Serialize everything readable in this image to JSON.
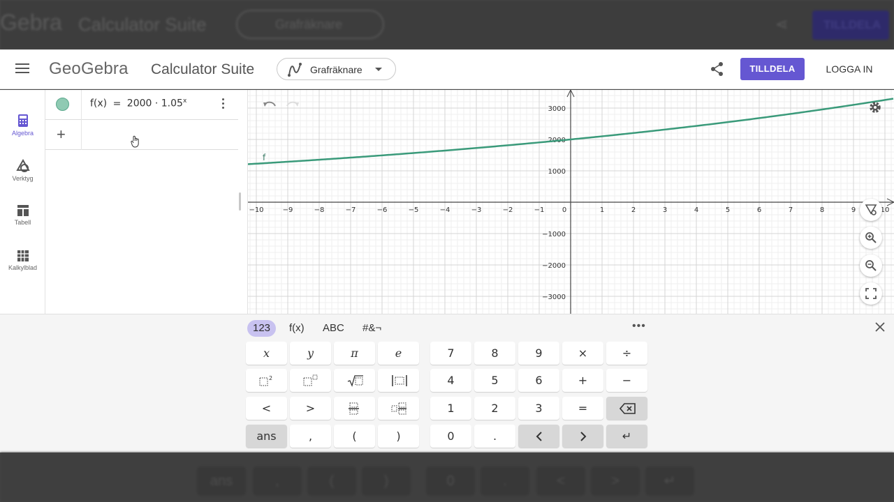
{
  "backdrop": {
    "logo": "Gebra",
    "suite": "Calculator Suite",
    "picker": "Grafräknare",
    "assign": "TILLDELA",
    "keys": [
      "ans",
      ",",
      "(",
      ")",
      "0",
      ".",
      "<",
      ">",
      "↵"
    ]
  },
  "header": {
    "logo": "GeoGebra",
    "suite_title": "Calculator Suite",
    "app_picker": "Grafräknare",
    "assign_label": "TILLDELA",
    "login_label": "LOGGA IN"
  },
  "rail": [
    {
      "label": "Algebra",
      "icon": "calculator-icon",
      "active": true
    },
    {
      "label": "Verktyg",
      "icon": "tools-icon",
      "active": false
    },
    {
      "label": "Tabell",
      "icon": "table-icon",
      "active": false
    },
    {
      "label": "Kalkylblad",
      "icon": "spreadsheet-icon",
      "active": false
    }
  ],
  "algebra": {
    "formula_lhs": "f(x)",
    "formula_eq": "=",
    "formula_rhs": "2000 · 1.05",
    "formula_exp": "x",
    "marble_color": "#8fcab3"
  },
  "graph": {
    "function_label": "f",
    "curve_color": "#3a9a7a",
    "x_ticks": [
      "−10",
      "−9",
      "−8",
      "−7",
      "−6",
      "−5",
      "−4",
      "−3",
      "−2",
      "−1",
      "0",
      "1",
      "2",
      "3",
      "4",
      "5",
      "6",
      "7",
      "8",
      "9",
      "10"
    ],
    "y_ticks": [
      "3000",
      "2000",
      "1000",
      "−1000",
      "−2000",
      "−3000"
    ],
    "xlim": [
      -10,
      10
    ],
    "ylim": [
      -3000,
      3000
    ]
  },
  "keyboard": {
    "tabs": [
      "123",
      "f(x)",
      "ABC",
      "#&¬"
    ],
    "more": "•••",
    "rows": [
      [
        {
          "l": "x",
          "s": "it"
        },
        {
          "l": "y",
          "s": "it"
        },
        {
          "l": "π",
          "s": "it"
        },
        {
          "l": "e",
          "s": "it"
        },
        {
          "l": "7"
        },
        {
          "l": "8"
        },
        {
          "l": "9"
        },
        {
          "l": "×"
        },
        {
          "l": "÷"
        }
      ],
      [
        {
          "l": "",
          "s": "sq"
        },
        {
          "l": "",
          "s": "pow"
        },
        {
          "l": "",
          "s": "sqrt"
        },
        {
          "l": "",
          "s": "abs"
        },
        {
          "l": "4"
        },
        {
          "l": "5"
        },
        {
          "l": "6"
        },
        {
          "l": "+"
        },
        {
          "l": "−"
        }
      ],
      [
        {
          "l": "<"
        },
        {
          "l": ">"
        },
        {
          "l": "",
          "s": "frac"
        },
        {
          "l": "",
          "s": "mixed"
        },
        {
          "l": "1"
        },
        {
          "l": "2"
        },
        {
          "l": "3"
        },
        {
          "l": "="
        },
        {
          "l": "",
          "s": "back",
          "g": true
        }
      ],
      [
        {
          "l": "ans",
          "g": true
        },
        {
          "l": ","
        },
        {
          "l": "("
        },
        {
          "l": ")"
        },
        {
          "l": "0"
        },
        {
          "l": "."
        },
        {
          "l": "<",
          "g": true
        },
        {
          "l": ">",
          "g": true
        },
        {
          "l": "↵",
          "g": true
        }
      ]
    ]
  },
  "accent_color": "#6557d2"
}
